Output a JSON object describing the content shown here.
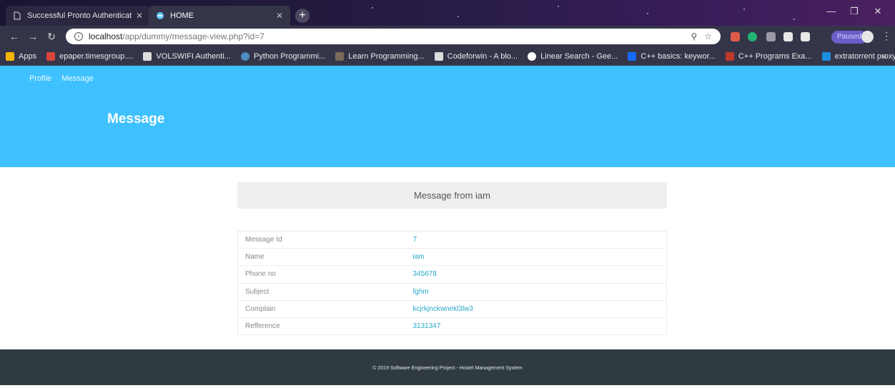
{
  "browser": {
    "tabs": [
      {
        "title": "Successful Pronto Authentication",
        "active": false
      },
      {
        "title": "HOME",
        "active": true
      }
    ],
    "url_host": "localhost",
    "url_path": "/app/dummy/message-view.php?id=7",
    "paused_label": "Paused",
    "bookmarks": [
      {
        "label": "Apps",
        "icon": "apps-grid-icon"
      },
      {
        "label": "epaper.timesgroup....",
        "icon": "epaper-icon"
      },
      {
        "label": "VOLSWIFI Authenti...",
        "icon": "page-icon"
      },
      {
        "label": "Python Programmi...",
        "icon": "python-icon"
      },
      {
        "label": "Learn Programming...",
        "icon": "learn-icon"
      },
      {
        "label": "Codeforwin - A blo...",
        "icon": "page-icon"
      },
      {
        "label": "Linear Search - Gee...",
        "icon": "google-icon"
      },
      {
        "label": "C++ basics: keywor...",
        "icon": "behance-icon"
      },
      {
        "label": "C++ Programs Exa...",
        "icon": "cpp-icon"
      },
      {
        "label": "extratorrent proxy -...",
        "icon": "is-icon"
      }
    ]
  },
  "nav": {
    "profile": "Profile",
    "message": "Message"
  },
  "hero": {
    "title": "Message"
  },
  "panel": {
    "heading": "Message from iam"
  },
  "details": [
    {
      "label": "Message Id",
      "value": "7"
    },
    {
      "label": "Name",
      "value": "iam"
    },
    {
      "label": "Phone no",
      "value": "345678"
    },
    {
      "label": "Subject",
      "value": "fghm"
    },
    {
      "label": "Complain",
      "value": "kcjrkjnckwnekl3lw3"
    },
    {
      "label": "Refference",
      "value": "3131347"
    }
  ],
  "footer": {
    "text": "© 2019 Software Engineering Project - Hostel Management System"
  },
  "colors": {
    "hero": "#3fc1ff",
    "footer": "#2f3b40",
    "value_text": "#2aa7c9"
  }
}
